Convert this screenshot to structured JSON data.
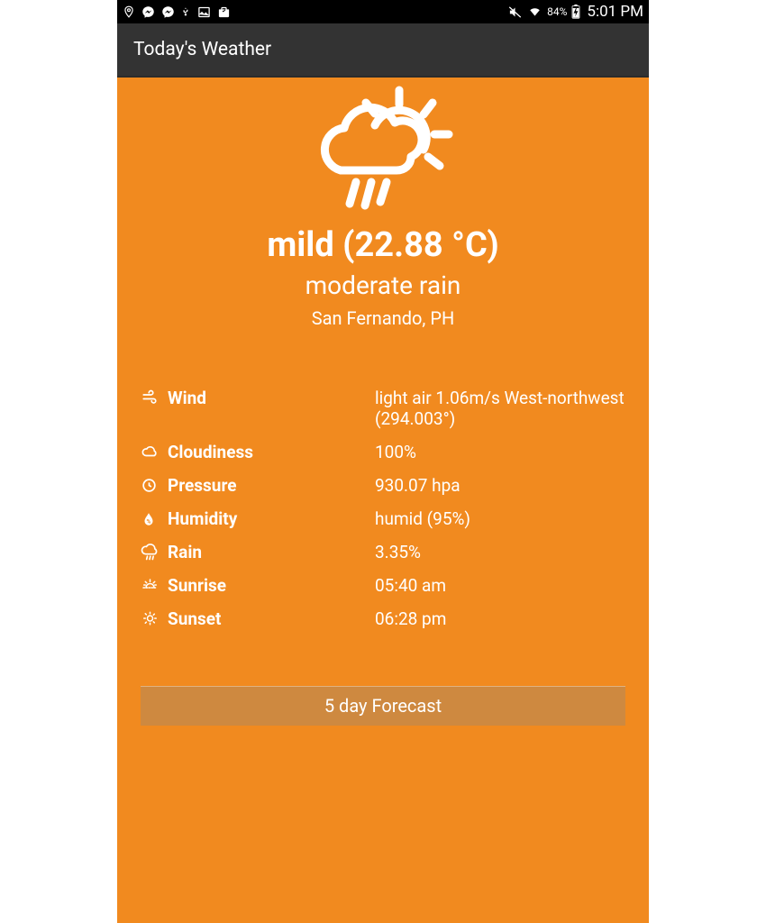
{
  "status_bar": {
    "battery_pct": "84%",
    "clock": "5:01 PM"
  },
  "app_bar": {
    "title": "Today's Weather"
  },
  "hero": {
    "temp_line": "mild (22.88 °C)",
    "condition": "moderate rain",
    "location": "San Fernando, PH"
  },
  "details": {
    "wind": {
      "label": "Wind",
      "value": "light air 1.06m/s West-northwest (294.003°)"
    },
    "cloudiness": {
      "label": "Cloudiness",
      "value": "100%"
    },
    "pressure": {
      "label": "Pressure",
      "value": "930.07 hpa"
    },
    "humidity": {
      "label": "Humidity",
      "value": "humid (95%)"
    },
    "rain": {
      "label": "Rain",
      "value": "3.35%"
    },
    "sunrise": {
      "label": "Sunrise",
      "value": "05:40 am"
    },
    "sunset": {
      "label": "Sunset",
      "value": "06:28 pm"
    }
  },
  "forecast_button": "5 day Forecast"
}
